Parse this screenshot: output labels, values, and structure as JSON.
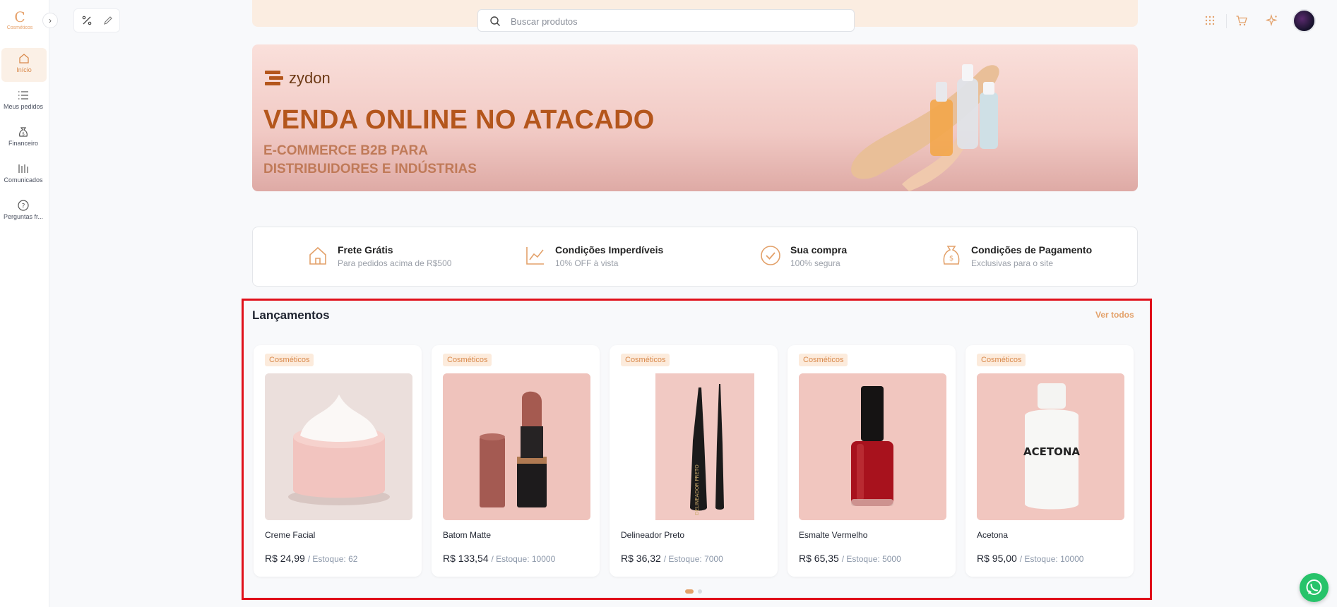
{
  "app": {
    "logo_mark": "C",
    "logo_sub": "Cosméticos"
  },
  "sidebar": {
    "items": [
      {
        "label": "Início",
        "icon": "home-icon",
        "active": true
      },
      {
        "label": "Meus pedidos",
        "icon": "list-icon",
        "active": false
      },
      {
        "label": "Financeiro",
        "icon": "money-bag-icon",
        "active": false
      },
      {
        "label": "Comunicados",
        "icon": "bar-list-icon",
        "active": false
      },
      {
        "label": "Perguntas fr...",
        "icon": "help-circle-icon",
        "active": false
      }
    ]
  },
  "search": {
    "placeholder": "Buscar produtos",
    "value": ""
  },
  "banner": {
    "brand": "zydon",
    "headline": "VENDA ONLINE NO ATACADO",
    "subline": "E-COMMERCE B2B PARA DISTRIBUIDORES E INDÚSTRIAS"
  },
  "features": [
    {
      "title": "Frete Grátis",
      "subtitle": "Para pedidos acima de R$500",
      "icon": "house-icon"
    },
    {
      "title": "Condições Imperdíveis",
      "subtitle": "10% OFF à vista",
      "icon": "chart-line-icon"
    },
    {
      "title": "Sua compra",
      "subtitle": "100% segura",
      "icon": "check-circle-icon"
    },
    {
      "title": "Condições de Pagamento",
      "subtitle": "Exclusivas para o site",
      "icon": "money-bag-icon"
    }
  ],
  "launches": {
    "title": "Lançamentos",
    "see_all": "Ver todos",
    "products": [
      {
        "category": "Cosméticos",
        "name": "Creme Facial",
        "price": "R$ 24,99",
        "stock": "/ Estoque: 62"
      },
      {
        "category": "Cosméticos",
        "name": "Batom Matte",
        "price": "R$ 133,54",
        "stock": "/ Estoque: 10000"
      },
      {
        "category": "Cosméticos",
        "name": "Delineador Preto",
        "price": "R$ 36,32",
        "stock": "/ Estoque: 7000",
        "label_on_product": "DELINEADOR PRETO"
      },
      {
        "category": "Cosméticos",
        "name": "Esmalte Vermelho",
        "price": "R$ 65,35",
        "stock": "/ Estoque: 5000"
      },
      {
        "category": "Cosméticos",
        "name": "Acetona",
        "price": "R$ 95,00",
        "stock": "/ Estoque: 10000",
        "label_on_product": "ACETONA"
      }
    ],
    "carousel_page": 1,
    "carousel_pages": 2
  },
  "colors": {
    "accent": "#e3a16a",
    "highlight_border": "#e0101a",
    "whatsapp": "#27c36a"
  }
}
